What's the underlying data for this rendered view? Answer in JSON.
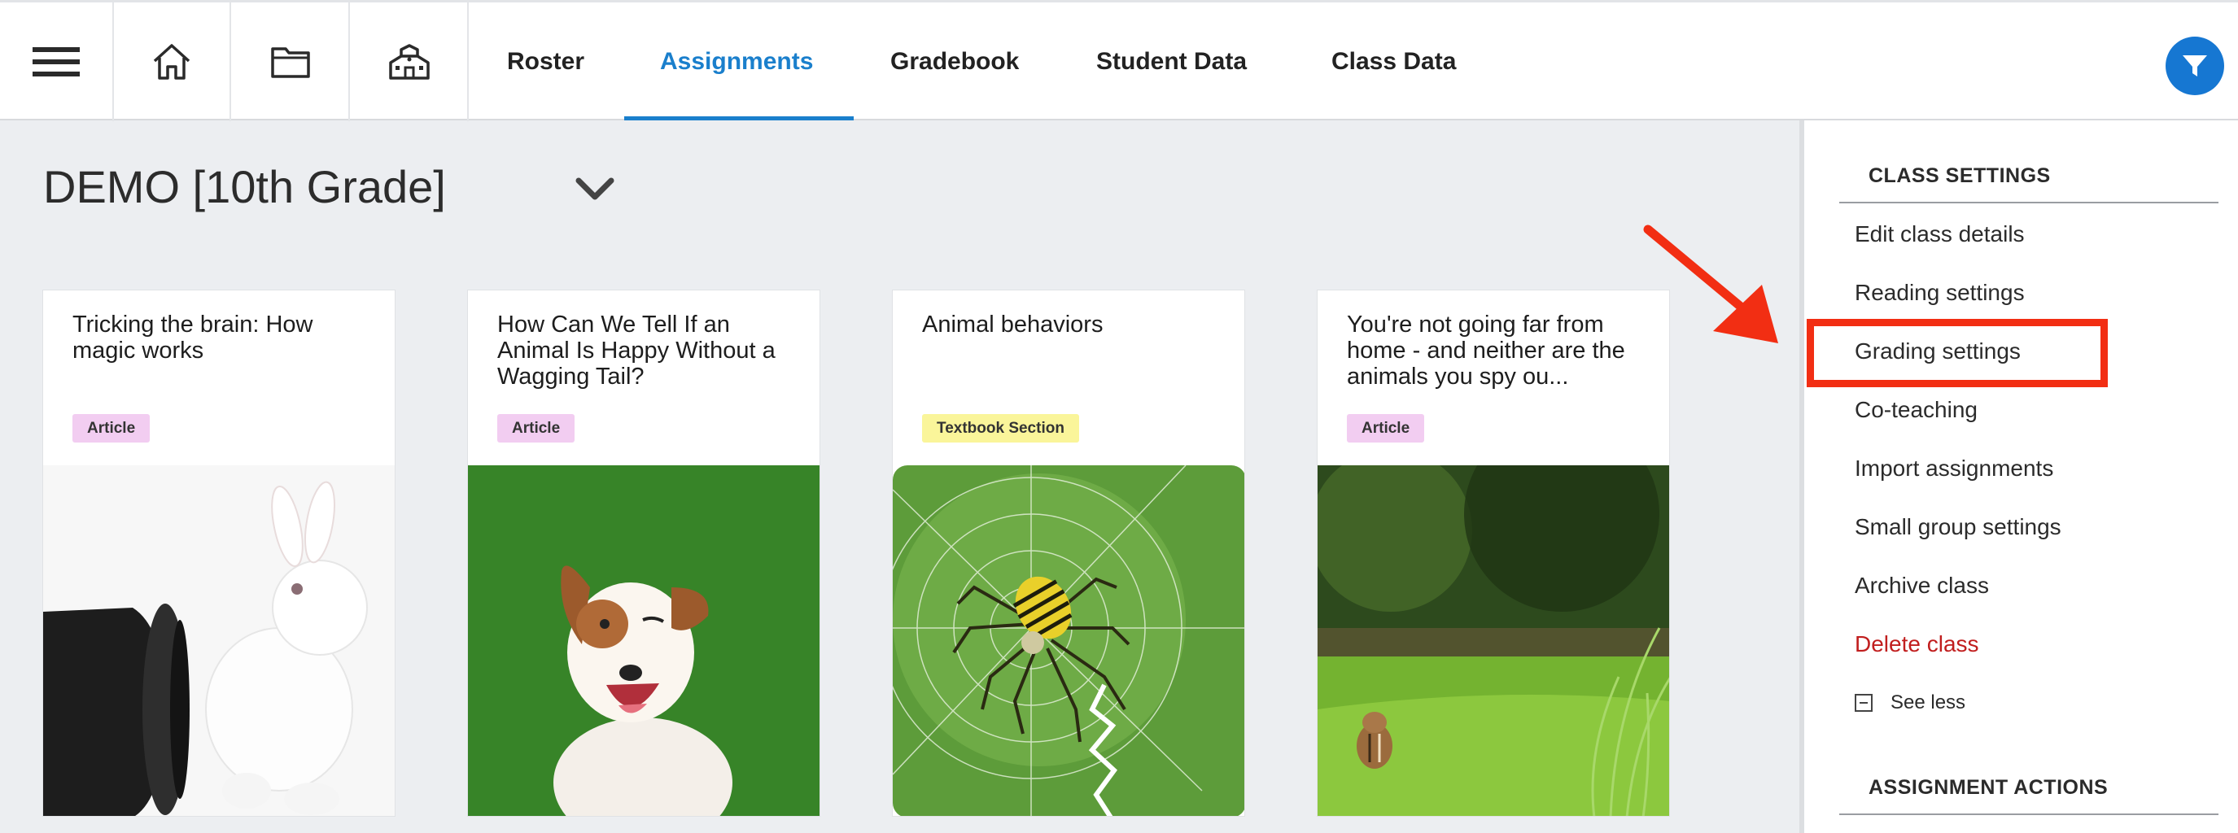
{
  "nav": {
    "icons": [
      "menu-icon",
      "home-icon",
      "folder-icon",
      "school-icon"
    ],
    "tabs": [
      {
        "label": "Roster",
        "active": false
      },
      {
        "label": "Assignments",
        "active": true
      },
      {
        "label": "Gradebook",
        "active": false
      },
      {
        "label": "Student Data",
        "active": false
      },
      {
        "label": "Class Data",
        "active": false
      }
    ],
    "filter_icon": "filter-icon",
    "accent_color": "#1a7fcc"
  },
  "class_selector": {
    "title": "DEMO [10th Grade]",
    "icon": "chevron-down-icon"
  },
  "assignments": [
    {
      "title": "Tricking the brain: How magic works",
      "badge": "Article",
      "badge_color": "#f2cdf1",
      "image": "rabbit-and-top-hat"
    },
    {
      "title": "How Can We Tell If an Animal Is Happy Without a Wagging Tail?",
      "badge": "Article",
      "badge_color": "#f2cdf1",
      "image": "happy-dog-on-grass"
    },
    {
      "title": "Animal behaviors",
      "badge": "Textbook Section",
      "badge_color": "#faf59a",
      "image": "spider-on-web"
    },
    {
      "title": "You're not going far from home - and neither are the animals you spy ou...",
      "badge": "Article",
      "badge_color": "#f2cdf1",
      "image": "chipmunk-in-grass"
    }
  ],
  "sidebar": {
    "class_settings_heading": "CLASS SETTINGS",
    "items": [
      {
        "label": "Edit class details",
        "danger": false
      },
      {
        "label": "Reading settings",
        "danger": false
      },
      {
        "label": "Grading settings",
        "danger": false
      },
      {
        "label": "Co-teaching",
        "danger": false
      },
      {
        "label": "Import assignments",
        "danger": false
      },
      {
        "label": "Small group settings",
        "danger": false
      },
      {
        "label": "Archive class",
        "danger": false
      },
      {
        "label": "Delete class",
        "danger": true
      }
    ],
    "see_less": "See less",
    "see_less_icon": "minus-square-icon",
    "assignment_actions_heading": "ASSIGNMENT ACTIONS"
  },
  "annotation": {
    "highlight_color": "#f22e13",
    "highlighted_item": "Grading settings"
  }
}
